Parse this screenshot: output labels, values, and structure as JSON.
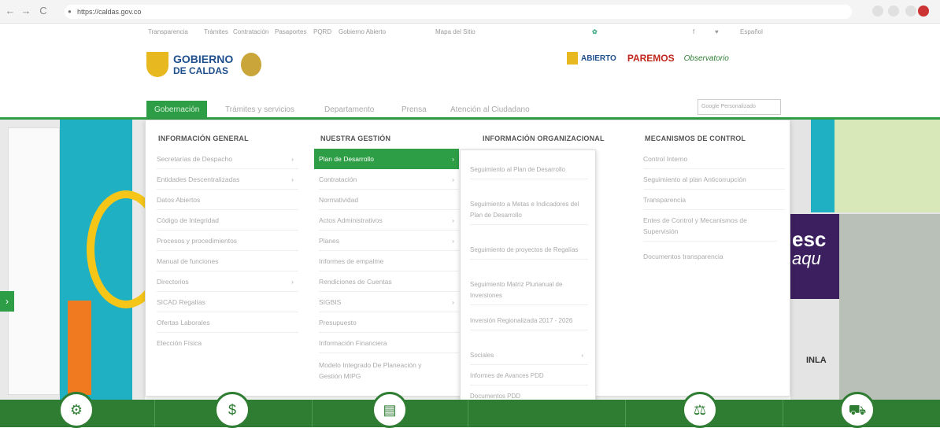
{
  "browser": {
    "url": "https://caldas.gov.co",
    "back_icon": "←",
    "forward_icon": "→",
    "reload_icon": "C"
  },
  "utility_bar": {
    "links": [
      "Transparencia",
      "Trámites",
      "Contratación",
      "Pasaportes",
      "PQRD",
      "Gobierno Abierto",
      "Mapa del Sitio"
    ],
    "social": [
      "f",
      "♥"
    ],
    "language": "Español"
  },
  "header": {
    "logo_title": "GOBIERNO",
    "logo_subtitle": "DE CALDAS",
    "partner_logos": [
      "ABIERTO",
      "PAREMOS",
      "Observatorio"
    ]
  },
  "main_nav": {
    "items": [
      "Gobernación",
      "Trámites y servicios",
      "Departamento",
      "Prensa",
      "Atención al Ciudadano"
    ],
    "active_index": 0,
    "search_placeholder": "Google Personalizado"
  },
  "mega_menu": {
    "columns": [
      {
        "heading": "INFORMACIÓN GENERAL",
        "items": [
          {
            "label": "Secretarías de Despacho",
            "arrow": true
          },
          {
            "label": "Entidades Descentralizadas",
            "arrow": true
          },
          {
            "label": "Datos Abiertos",
            "arrow": false
          },
          {
            "label": "Código de Integridad",
            "arrow": false
          },
          {
            "label": "Procesos y procedimientos",
            "arrow": false
          },
          {
            "label": "Manual de funciones",
            "arrow": false
          },
          {
            "label": "Directorios",
            "arrow": true
          },
          {
            "label": "SICAD Regalías",
            "arrow": false
          },
          {
            "label": "Ofertas Laborales",
            "arrow": false
          },
          {
            "label": "Elección Física",
            "arrow": false
          }
        ]
      },
      {
        "heading": "NUESTRA GESTIÓN",
        "items": [
          {
            "label": "Plan de Desarrollo",
            "arrow": true,
            "highlight": true
          },
          {
            "label": "Contratación",
            "arrow": true
          },
          {
            "label": "Normatividad",
            "arrow": false
          },
          {
            "label": "Actos Administrativos",
            "arrow": true
          },
          {
            "label": "Planes",
            "arrow": true
          },
          {
            "label": "Informes de empalme",
            "arrow": false
          },
          {
            "label": "Rendiciones de Cuentas",
            "arrow": false
          },
          {
            "label": "SIGBIS",
            "arrow": true
          },
          {
            "label": "Presupuesto",
            "arrow": false
          },
          {
            "label": "Información Financiera",
            "arrow": false
          },
          {
            "label": "Modelo Integrado De Planeación y Gestión MIPG",
            "arrow": false
          }
        ]
      },
      {
        "heading": "INFORMACIÓN ORGANIZACIONAL",
        "items": []
      },
      {
        "heading": "MECANISMOS DE CONTROL",
        "items": [
          {
            "label": "Control Interno",
            "arrow": false
          },
          {
            "label": "Seguimiento al plan Anticorrupción",
            "arrow": false
          },
          {
            "label": "Transparencia",
            "arrow": false
          },
          {
            "label": "Entes de Control y Mecanismos de Supervisión",
            "arrow": false
          },
          {
            "label": "Documentos transparencia",
            "arrow": false
          }
        ]
      }
    ],
    "submenu": [
      {
        "label": "Seguimiento al Plan de Desarrollo"
      },
      {
        "label": "Seguimiento a Metas e Indicadores del Plan de Desarrollo"
      },
      {
        "label": "Seguimiento de proyectos de Regalías"
      },
      {
        "label": "Seguimiento Matriz Plurianual de Inversiones"
      },
      {
        "label": "Inversión Regionalizada 2017 - 2026"
      },
      {
        "label": "Sociales"
      },
      {
        "label": "Informes de Avances PDD"
      },
      {
        "label": "Documentos PDD"
      }
    ]
  },
  "banners": {
    "right_text_1": "esc",
    "right_text_2": "aqu",
    "right_label": "INLA"
  },
  "colors": {
    "accent": "#2e9e46",
    "footer": "#2e7d32"
  }
}
